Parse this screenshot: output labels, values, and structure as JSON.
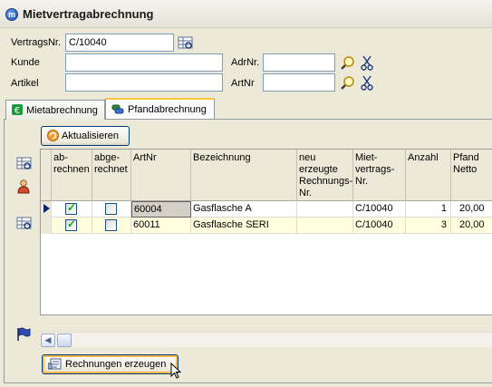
{
  "window": {
    "title": "Mietvertragabrechnung"
  },
  "form": {
    "vertragsnr_label": "VertragsNr.",
    "vertragsnr_value": "C/10040",
    "kunde_label": "Kunde",
    "kunde_value": "",
    "adrnr_label": "AdrNr.",
    "adrnr_value": "",
    "artikel_label": "Artikel",
    "artikel_value": "",
    "artnr_label": "ArtNr",
    "artnr_value": ""
  },
  "tabs": [
    {
      "label": "Mietabrechnung",
      "icon": "money-icon",
      "active": false
    },
    {
      "label": "Pfandabrechnung",
      "icon": "bottles-icon",
      "active": true
    }
  ],
  "toolbar": {
    "refresh_label": "Aktualisieren"
  },
  "grid": {
    "columns": [
      "ab-\nrechnen",
      "abge-\nrechnet",
      "ArtNr",
      "Bezeichnung",
      "neu\nerzeugte\nRechnungs-\nNr.",
      "Miet-\nvertrags-\nNr.",
      "Anzahl",
      "Pfand\nNetto"
    ],
    "rows": [
      {
        "abrechnen": true,
        "abgerechnet": false,
        "artnr": "60004",
        "bezeichnung": "Gasflasche A",
        "neue_rechnungsnr": "",
        "mietvertragsnr": "C/10040",
        "anzahl": "1",
        "pfand_netto": "20,00"
      },
      {
        "abrechnen": true,
        "abgerechnet": false,
        "artnr": "60011",
        "bezeichnung": "Gasflasche SERI",
        "neue_rechnungsnr": "",
        "mietvertragsnr": "C/10040",
        "anzahl": "3",
        "pfand_netto": "20,00"
      }
    ]
  },
  "footer": {
    "create_invoices_label": "Rechnungen erzeugen"
  },
  "colors": {
    "accent": "#ffc73c",
    "row_alt": "#ffffe0",
    "field_border": "#7f9db9"
  }
}
